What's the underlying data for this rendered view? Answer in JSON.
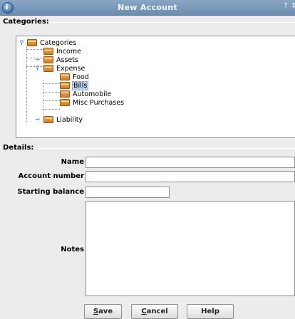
{
  "window": {
    "title": "New Account",
    "controls": [
      "↑",
      "⇕"
    ]
  },
  "categories_section": {
    "label": "Categories:",
    "tree": [
      {
        "label": "Categories",
        "expanded": true
      },
      {
        "label": "Income"
      },
      {
        "label": "Assets",
        "expanded": false
      },
      {
        "label": "Expense",
        "expanded": true
      },
      {
        "label": "Food"
      },
      {
        "label": "Bills",
        "selected": true
      },
      {
        "label": "Automobile"
      },
      {
        "label": "Misc Purchases"
      },
      {
        "label": "Liability",
        "expanded": false
      }
    ]
  },
  "details_section": {
    "label": "Details:",
    "name_label": "Name",
    "name_value": "",
    "account_number_label": "Account number",
    "account_number_value": "",
    "starting_balance_label": "Starting balance",
    "starting_balance_value": "",
    "notes_label": "Notes",
    "notes_value": ""
  },
  "buttons": {
    "save": {
      "mnemonic": "S",
      "rest": "ave"
    },
    "cancel": {
      "mnemonic": "C",
      "rest": "ancel"
    },
    "help": "Help"
  },
  "colors": {
    "title_bar": "#7b9abd",
    "selection": "#b8cfe5",
    "folder": "#e39a40"
  }
}
